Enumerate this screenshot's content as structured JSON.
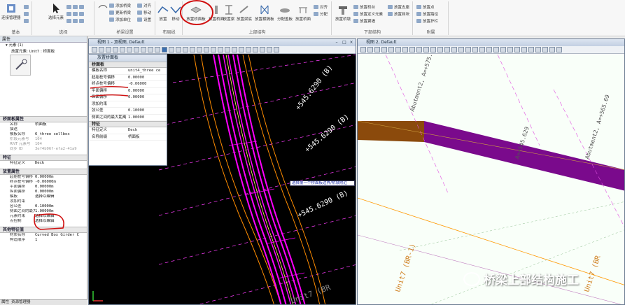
{
  "ribbon": {
    "groups": [
      {
        "label": "基本"
      },
      {
        "label": "选择"
      },
      {
        "label": "桥梁设置"
      },
      {
        "label": "布局线"
      },
      {
        "label": "上部结构"
      },
      {
        "label": "下部结构"
      },
      {
        "label": "附属"
      }
    ],
    "basic": {
      "manager_label": "连接管理器"
    },
    "select": {
      "select_label": "选择元素"
    },
    "bridge_setup": {
      "items": [
        "添加桥梁",
        "更新桥梁",
        "添加单位",
        "对齐",
        "移动",
        "设置"
      ]
    },
    "layout": {
      "items": [
        "放置",
        "移动"
      ]
    },
    "superstructure": {
      "items": [
        "放置桥面板",
        "放置桥面",
        "放置梁",
        "放置梁底",
        "放置横隔板",
        "分配盖板",
        "放置桥面",
        "对齐",
        "分配"
      ],
      "active_label": "放置桥面板"
    },
    "substructure": {
      "items": [
        "放置桥墩",
        "放置桥台",
        "放置定义元素",
        "放置翼墙",
        "放置支座",
        "放置挡块"
      ]
    },
    "auxiliary": {
      "items": [
        "放置点",
        "放置路径",
        "放置护栏"
      ]
    }
  },
  "left_panel": {
    "title": "属性",
    "element_label": "元素 (1)",
    "element_sub": "放置元素: Unit7 : 桥面板",
    "section_deck": "桥面板属性",
    "deck_rows": [
      {
        "k": "名称",
        "v": "桥面板",
        "grey": false
      },
      {
        "k": "描述",
        "v": "",
        "grey": false
      },
      {
        "k": "模板名称",
        "v": "6_three cellbox",
        "grey": false
      },
      {
        "k": "阶段元素号",
        "v": "104",
        "grey": true
      },
      {
        "k": "RNT 元素号",
        "v": "104",
        "grey": true
      },
      {
        "k": "同步 ID",
        "v": "3ef4b96f-efa2-41a9",
        "grey": true
      }
    ],
    "section_feature": "特征",
    "feature_rows": [
      {
        "k": "特征定义",
        "v": "Deck"
      }
    ],
    "section_geometry": "放置属性",
    "geometry_rows": [
      {
        "k": "起始桩号偏移",
        "v": "0.00000m"
      },
      {
        "k": "终点桩号偏移",
        "v": "-0.06000m"
      },
      {
        "k": "平面偏移",
        "v": "0.00000m"
      },
      {
        "k": "纵面偏移",
        "v": "0.00000m"
      },
      {
        "k": "模板",
        "v": "选择以编辑"
      },
      {
        "k": "添加约束",
        "v": ""
      },
      {
        "k": "容公差",
        "v": "0.10000m"
      },
      {
        "k": "侧面之间的最大距离",
        "v": "1.00000m"
      },
      {
        "k": "元素约束",
        "v": "选择以编辑"
      },
      {
        "k": "点控制",
        "v": "选择以编辑"
      }
    ],
    "section_other": "其他特征值",
    "other_rows": [
      {
        "k": "材质名称",
        "v": "Curved Box Girder C"
      },
      {
        "k": "构造顺序",
        "v": "1"
      }
    ]
  },
  "dialog": {
    "title": "放置桥面板",
    "section_deck": "桥面板",
    "rows": [
      {
        "k": "模板名称",
        "v": "unit4_three ce"
      },
      {
        "k": "起始桩号偏移",
        "v": "0.00000"
      },
      {
        "k": "终点桩号偏移",
        "v": "-0.06000"
      },
      {
        "k": "平面偏移",
        "v": "0.00000"
      },
      {
        "k": "纵面偏移",
        "v": "0.00000"
      },
      {
        "k": "添加约束",
        "v": ""
      },
      {
        "k": "弦公差",
        "v": "0.10000"
      },
      {
        "k": "侧面之间的最大距离",
        "v": "1.00000"
      }
    ],
    "section_feature": "特征",
    "feature_rows": [
      {
        "k": "特征定义",
        "v": "Deck"
      },
      {
        "k": "名称前缀",
        "v": "桥面板"
      }
    ]
  },
  "view1": {
    "title": "视图 1 - 顶视图, Default"
  },
  "view2": {
    "title": "视图 2, Default"
  },
  "viewport_labels": {
    "station_a": "+545.6290 (B)",
    "station_b": "+545.6290 (B)",
    "station_c": "+545.6290 (B)",
    "unit_left": "Unit7 (BR",
    "unit_right_1": "Unit7 (BR-1)",
    "unit_right_2": "Unit7 (BR",
    "r_top": "Abutment2, A=+575.6",
    "r_mid": "A=+545.629",
    "r_right": "Abutment2, A=+565.69"
  },
  "tooltip": "选择第一个桥面板边界/桥墩附近",
  "watermark": "桥梁上部结构施工",
  "status": {
    "items": [
      "属性",
      "资源管理器"
    ]
  },
  "colors": {
    "deck_magenta": "#ff00ff",
    "alignment_orange": "#ff8c00",
    "purple": "#7a0a8c",
    "brown": "#8b4a0c",
    "annotation_red": "#d01010"
  }
}
